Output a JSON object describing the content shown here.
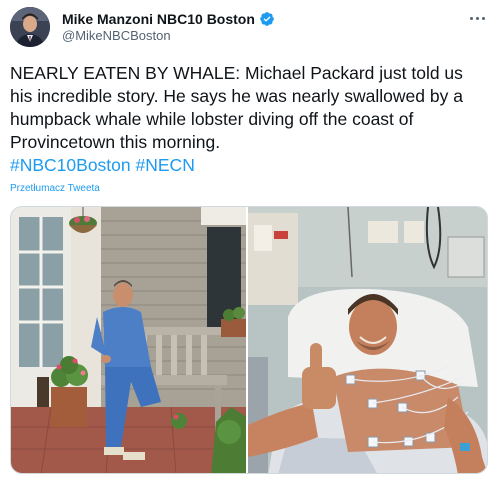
{
  "author": {
    "display_name": "Mike Manzoni NBC10 Boston",
    "handle": "@MikeNBCBoston",
    "verified": true
  },
  "tweet": {
    "text_plain": "NEARLY EATEN BY WHALE: Michael Packard just told us his incredible story. He says he was nearly swallowed by a humpback whale while lobster diving off the coast of Provincetown this morning.",
    "hashtags": [
      "#NBC10Boston",
      "#NECN"
    ],
    "translate_label": "Przetłumacz Tweeta"
  },
  "media": {
    "photos": [
      {
        "subject": "man in blue scrubs seated on wooden bench outside shingled house"
      },
      {
        "subject": "man in hospital bed giving thumbs up with ECG electrodes"
      }
    ]
  },
  "colors": {
    "accent": "#1d9bf0",
    "text": "#0f1419",
    "secondary": "#536471"
  }
}
